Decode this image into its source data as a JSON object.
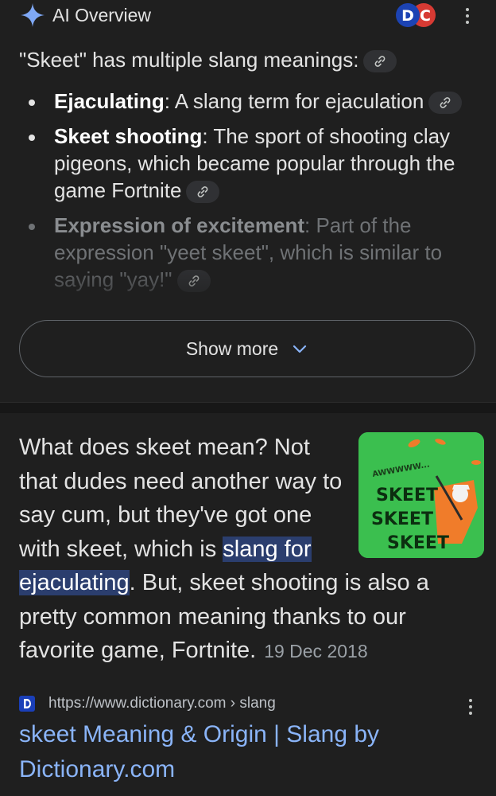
{
  "ai_overview": {
    "title": "AI Overview",
    "intro": "\"Skeet\" has multiple slang meanings:",
    "bullets": [
      {
        "term": "Ejaculating",
        "text": ": A slang term for ejaculation"
      },
      {
        "term": "Skeet shooting",
        "text": ": The sport of shooting clay pigeons, which became popular through the game Fortnite"
      },
      {
        "term": "Expression of excitement",
        "text": ": Part of the expression \"yeet skeet\", which is similar to saying \"yay!\""
      }
    ],
    "show_more_label": "Show more",
    "icons": {
      "spark": "gemini-spark-icon",
      "link": "link-icon",
      "chevron": "chevron-down-icon",
      "menu": "more-vert-icon"
    }
  },
  "result": {
    "snippet_before": "What does skeet mean? Not that dudes need another way to say cum, but they've got one with skeet, which is ",
    "snippet_highlight": "slang for ejaculating",
    "snippet_after": ". But, skeet shooting is also a pretty common meaning thanks to our favorite game, Fortnite.",
    "date": "19 Dec 2018",
    "thumbnail": {
      "lines": [
        "AWWWWW...",
        "SKEET",
        "SKEET",
        "SKEET"
      ]
    },
    "source_url": "https://www.dictionary.com › slang",
    "title": "skeet Meaning & Origin | Slang by Dictionary.com"
  },
  "colors": {
    "background": "#1f1f1f",
    "link": "#8ab4f8",
    "highlight": "#2b3e6e",
    "thumbnail_green": "#3bbf4f",
    "favicon": "#1a3fb8"
  }
}
